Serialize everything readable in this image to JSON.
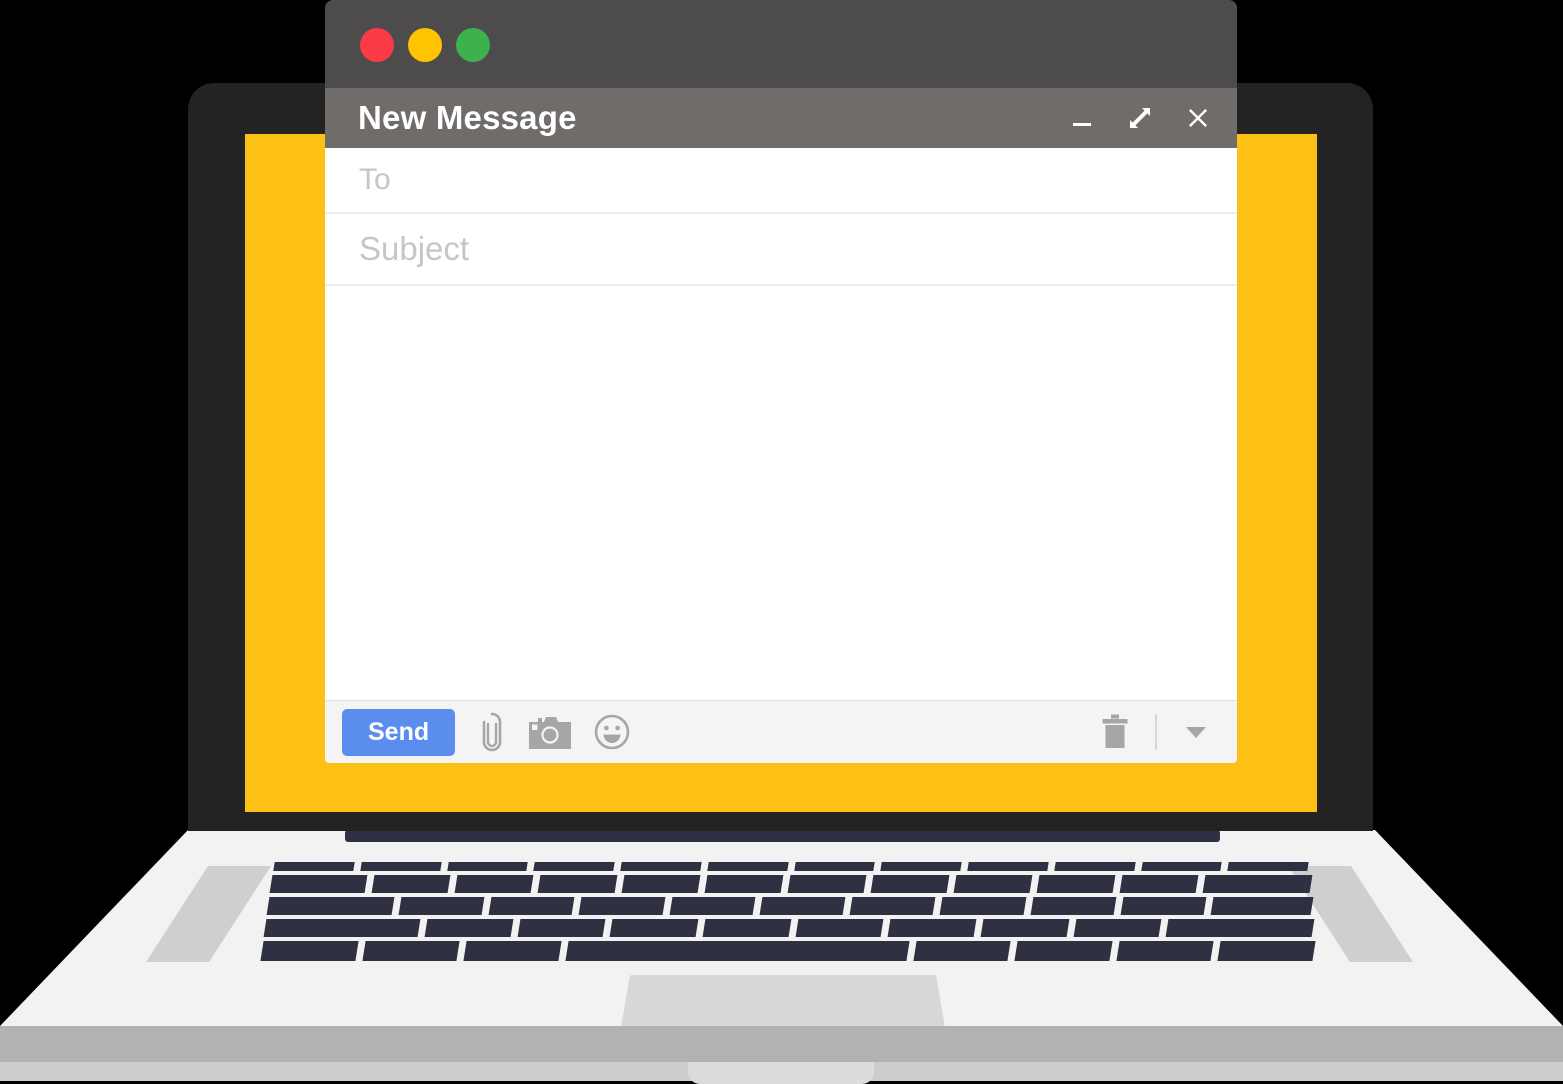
{
  "device": {
    "name": "laptop-illustration",
    "screen_color": "#FDC014",
    "bezel_color": "#232323",
    "deck_color": "#F2F2F2",
    "key_color": "#2F3142"
  },
  "window": {
    "title": "New Message",
    "titlebar_color": "#706C6A",
    "chrome_color": "#4D4B4B",
    "traffic_lights": [
      {
        "name": "close",
        "color": "#FA3A46"
      },
      {
        "name": "minimize",
        "color": "#FFC400"
      },
      {
        "name": "maximize",
        "color": "#3DB24C"
      }
    ],
    "controls": [
      {
        "name": "minimize-icon",
        "glyph": "_"
      },
      {
        "name": "expand-icon",
        "glyph": "arrows-diagonal"
      },
      {
        "name": "close-icon",
        "glyph": "x"
      }
    ]
  },
  "fields": {
    "to": {
      "placeholder": "To",
      "value": ""
    },
    "subject": {
      "placeholder": "Subject",
      "value": ""
    },
    "body": {
      "placeholder": "",
      "value": ""
    }
  },
  "toolbar": {
    "send_label": "Send",
    "send_color": "#5B8DEF",
    "icons": [
      {
        "name": "attach-icon",
        "label": "Attach file"
      },
      {
        "name": "camera-icon",
        "label": "Insert photo"
      },
      {
        "name": "emoji-icon",
        "label": "Insert emoji"
      }
    ],
    "right_icons": [
      {
        "name": "trash-icon",
        "label": "Discard draft"
      },
      {
        "name": "more-options-icon",
        "label": "More options"
      }
    ]
  }
}
